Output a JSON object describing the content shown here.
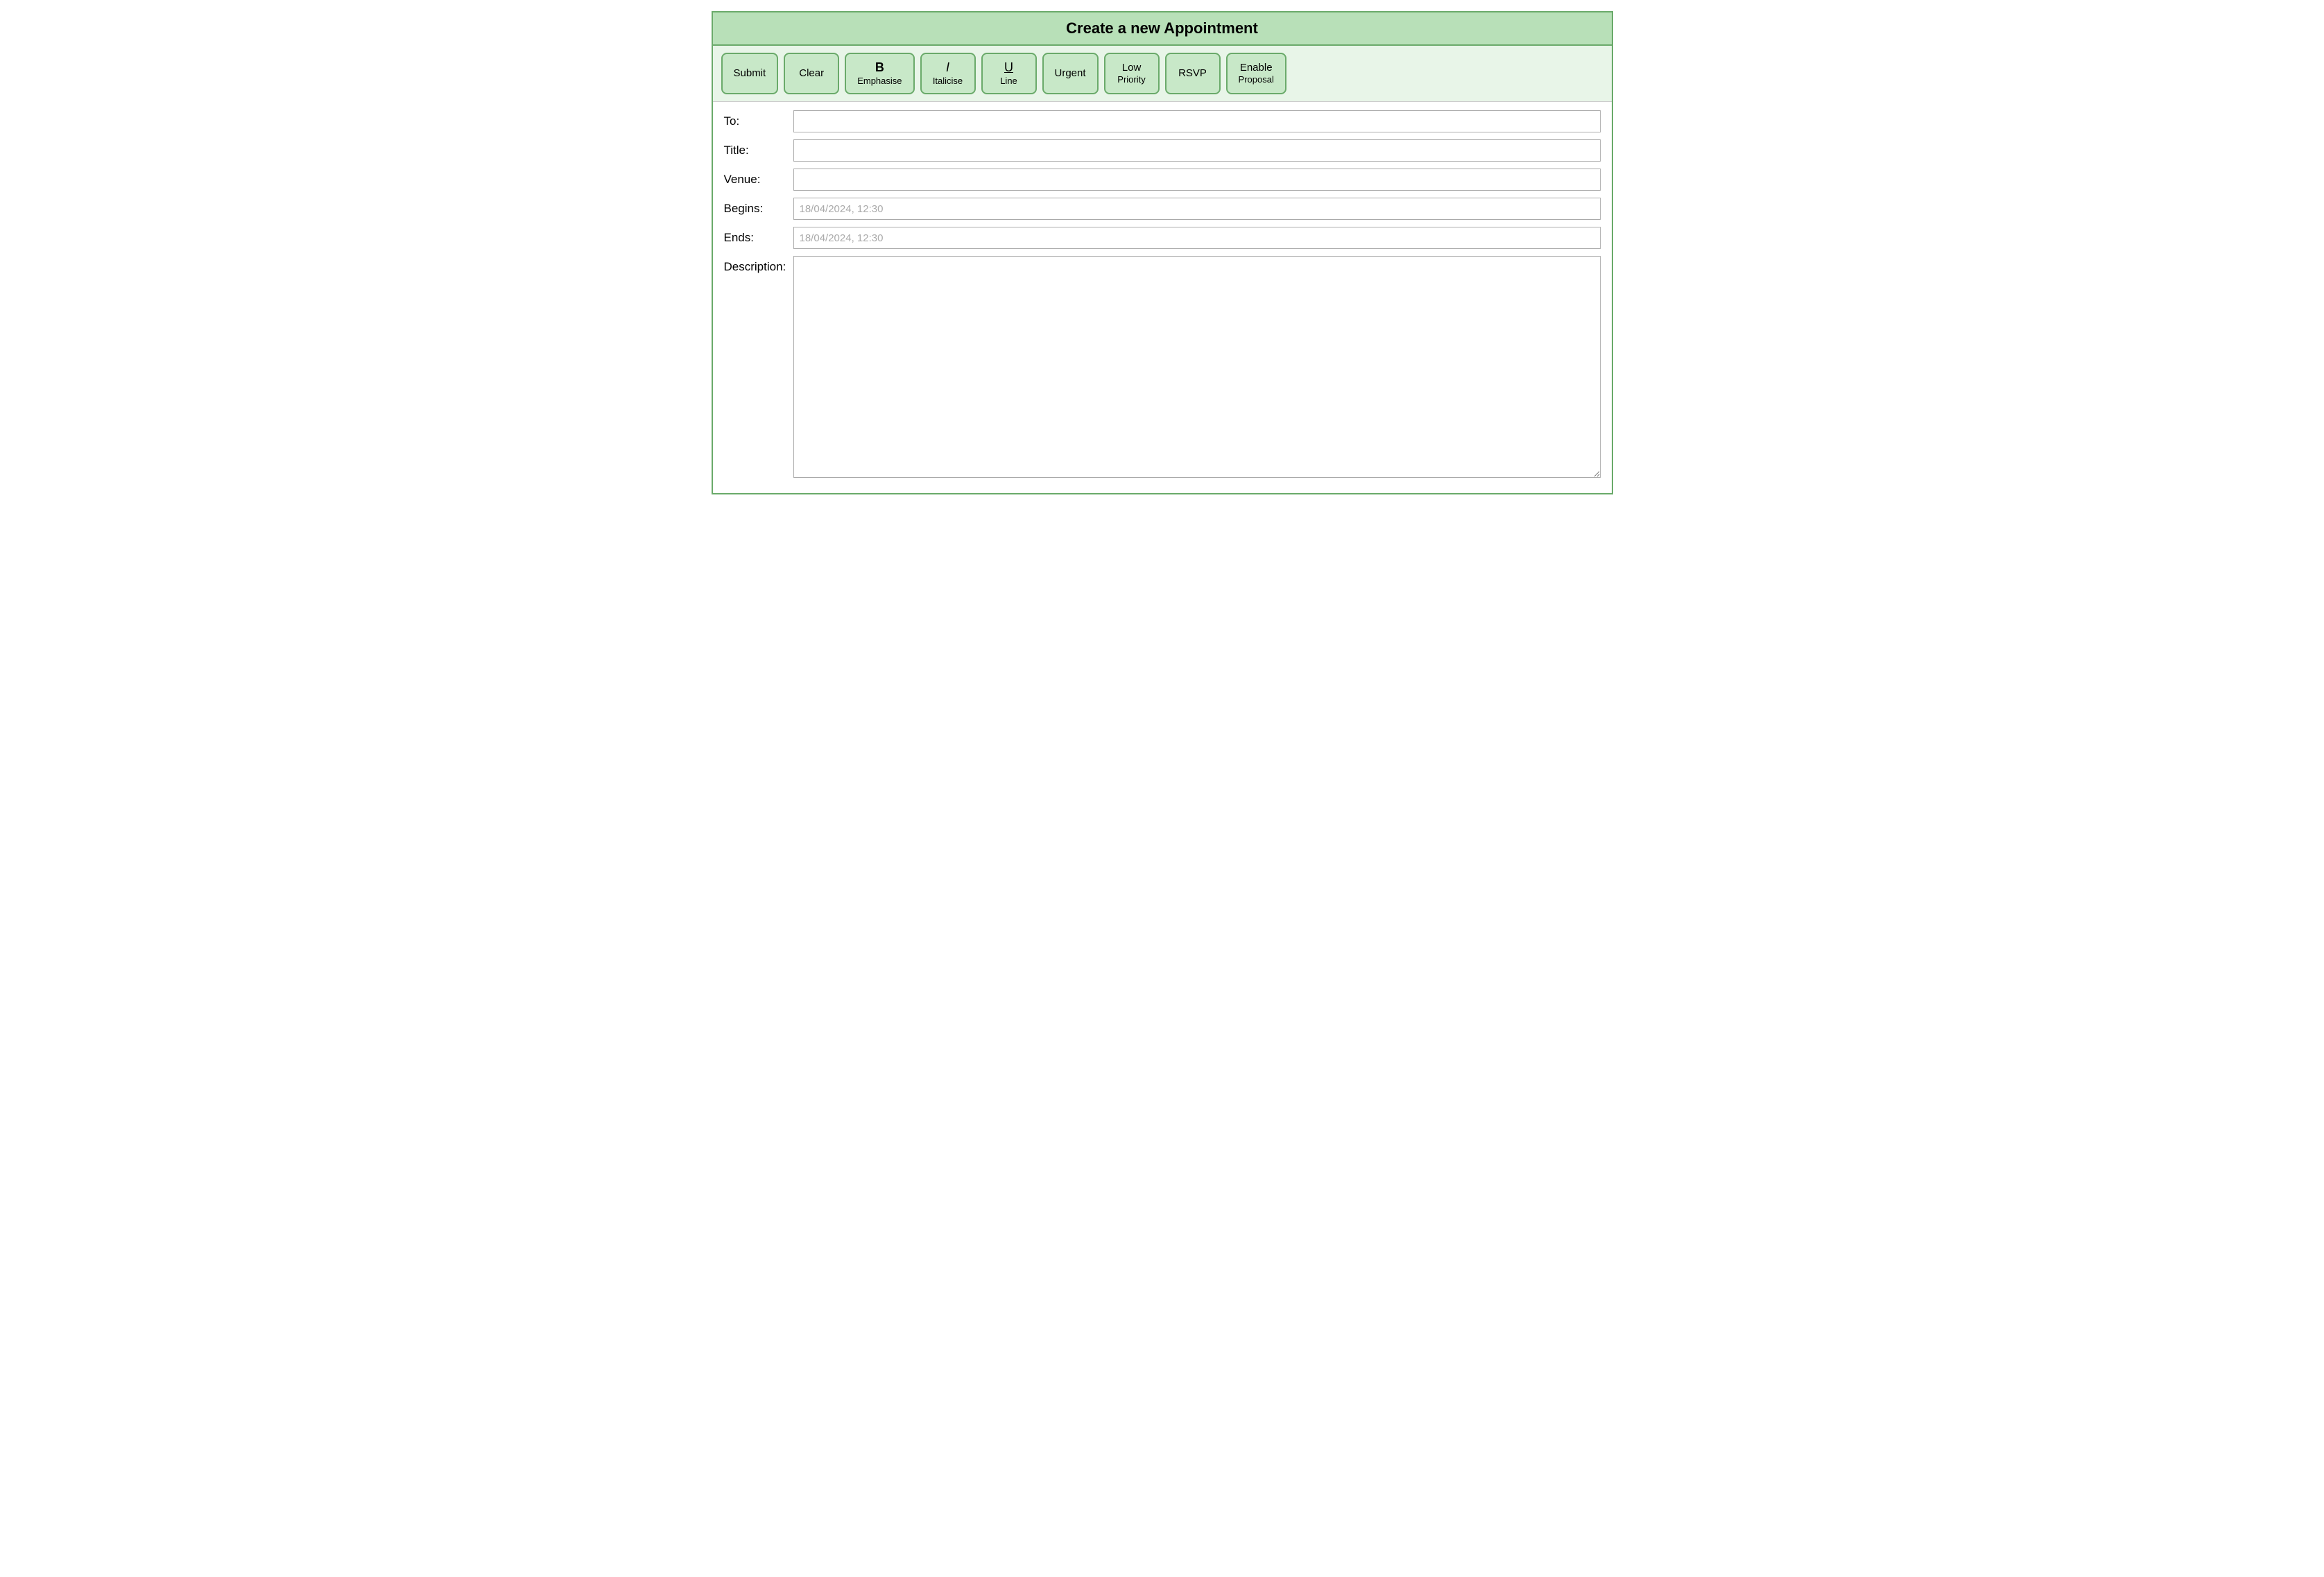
{
  "title": "Create a new Appointment",
  "toolbar": {
    "submit_label": "Submit",
    "clear_label": "Clear",
    "emphasise_top": "B",
    "emphasise_bottom": "Emphasise",
    "italicise_top": "I",
    "italicise_bottom": "Italicise",
    "underline_top": "U",
    "underline_bottom": "Line",
    "urgent_label": "Urgent",
    "low_priority_top": "Low",
    "low_priority_bottom": "Priority",
    "rsvp_label": "RSVP",
    "enable_proposal_top": "Enable",
    "enable_proposal_bottom": "Proposal"
  },
  "form": {
    "to_label": "To:",
    "title_label": "Title:",
    "venue_label": "Venue:",
    "begins_label": "Begins:",
    "ends_label": "Ends:",
    "description_label": "Description:",
    "begins_placeholder": "18/04/2024, 12:30",
    "ends_placeholder": "18/04/2024, 12:30",
    "to_value": "",
    "title_value": "",
    "venue_value": "",
    "description_value": ""
  }
}
